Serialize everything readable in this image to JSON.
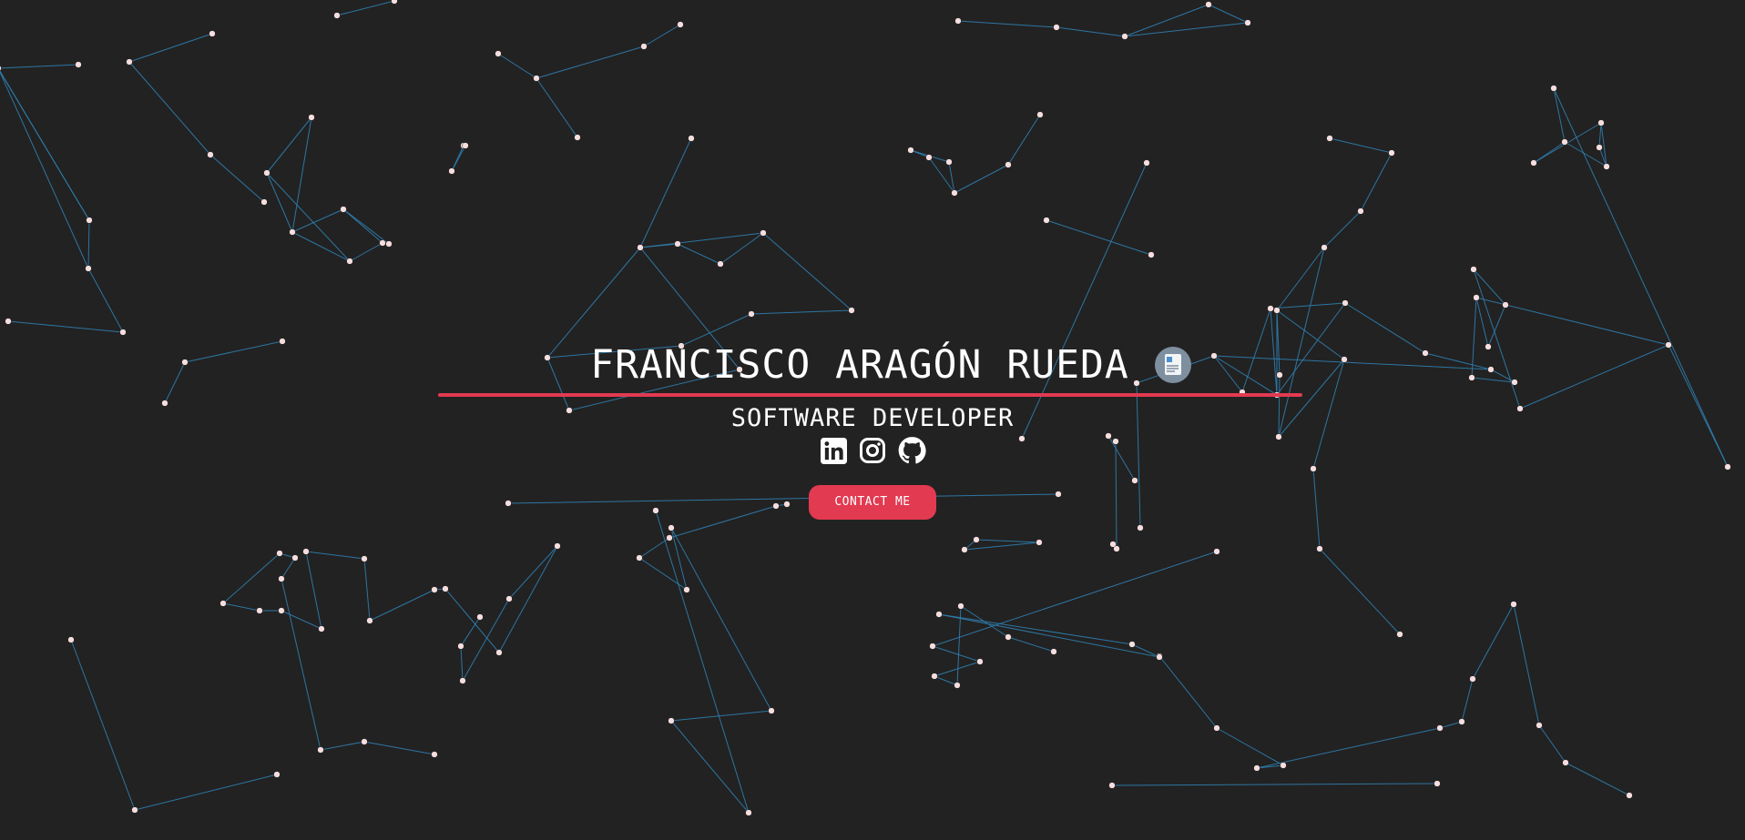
{
  "hero": {
    "name": "FRANCISCO ARAGÓN RUEDA",
    "subtitle": "SOFTWARE DEVELOPER",
    "contact_label": "CONTACT ME"
  },
  "icons": {
    "cv": "resume-document-icon",
    "linkedin": "linkedin-icon",
    "instagram": "instagram-icon",
    "github": "github-icon"
  },
  "colors": {
    "background": "#222222",
    "accent": "#e23a51",
    "text": "#ffffff",
    "network_line": "#2f7fb0",
    "network_node": "#f7dede",
    "cv_badge": "#7e8fa0"
  }
}
